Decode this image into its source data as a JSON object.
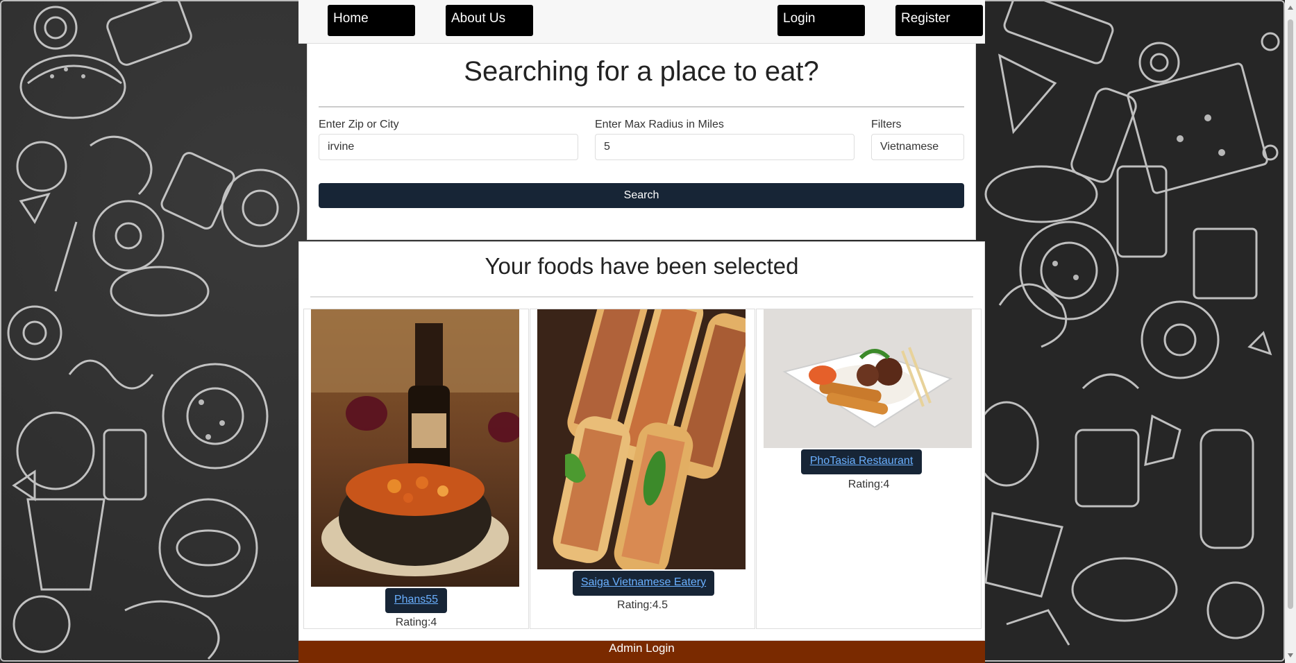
{
  "nav": {
    "home_label": "Home",
    "about_label": "About Us",
    "login_label": "Login",
    "register_label": "Register"
  },
  "search": {
    "title": "Searching for a place to eat?",
    "zip_label": "Enter Zip or City",
    "zip_value": "irvine",
    "radius_label": "Enter Max Radius in Miles",
    "radius_value": "5",
    "filters_label": "Filters",
    "filters_value": "Vietnamese",
    "search_button": "Search"
  },
  "results": {
    "title": "Your foods have been selected",
    "restaurants": [
      {
        "name": "Phans55",
        "rating": "Rating:4"
      },
      {
        "name": "Saiga Vietnamese Eatery",
        "rating": "Rating:4.5"
      },
      {
        "name": "PhoTasia Restaurant",
        "rating": "Rating:4"
      }
    ]
  },
  "footer": {
    "admin_login": "Admin Login"
  },
  "colors": {
    "nav_button": "#000000",
    "search_button": "#172536",
    "footer_bar": "#7a2a00",
    "link": "#6ab0ff"
  }
}
